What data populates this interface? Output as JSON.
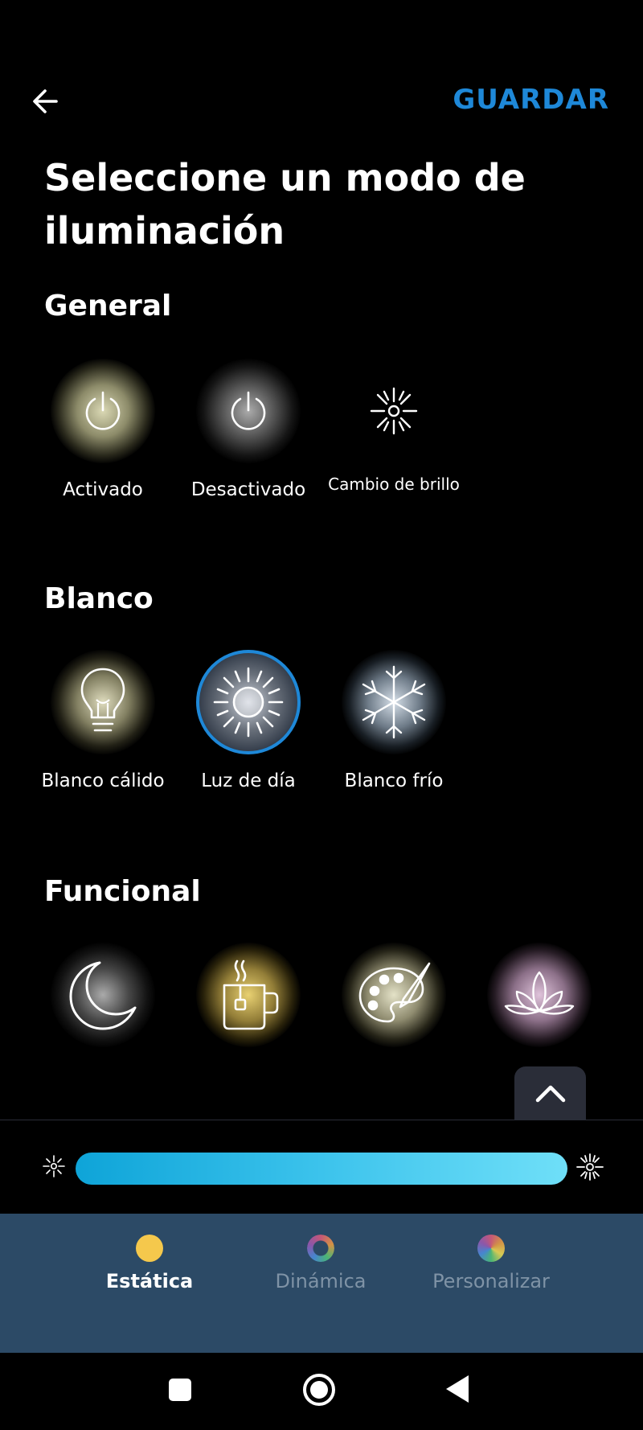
{
  "header": {
    "save_label": "GUARDAR",
    "title": "Seleccione un modo de iluminación"
  },
  "sections": {
    "general": {
      "title": "General",
      "items": [
        {
          "label": "Activado",
          "icon": "power-icon"
        },
        {
          "label": "Desactivado",
          "icon": "power-icon"
        },
        {
          "label": "Cambio de brillo",
          "icon": "brightness-icon"
        }
      ]
    },
    "blanco": {
      "title": "Blanco",
      "items": [
        {
          "label": "Blanco cálido",
          "icon": "bulb-icon"
        },
        {
          "label": "Luz de día",
          "icon": "sun-icon",
          "selected": true
        },
        {
          "label": "Blanco frío",
          "icon": "snowflake-icon"
        }
      ]
    },
    "funcional": {
      "title": "Funcional",
      "items": [
        {
          "icon": "moon-icon"
        },
        {
          "icon": "tea-cup-icon"
        },
        {
          "icon": "palette-icon"
        },
        {
          "icon": "lotus-icon"
        }
      ]
    }
  },
  "brightness": {
    "level": 1.0,
    "color_start": "#0ea4d8",
    "color_end": "#6fdff8"
  },
  "tabs": [
    {
      "label": "Estática",
      "active": true,
      "color": "#f5c84c"
    },
    {
      "label": "Dinámica",
      "active": false
    },
    {
      "label": "Personalizar",
      "active": false
    }
  ],
  "colors": {
    "accent": "#1e88d8",
    "tabbar_bg": "#2c4a66"
  }
}
